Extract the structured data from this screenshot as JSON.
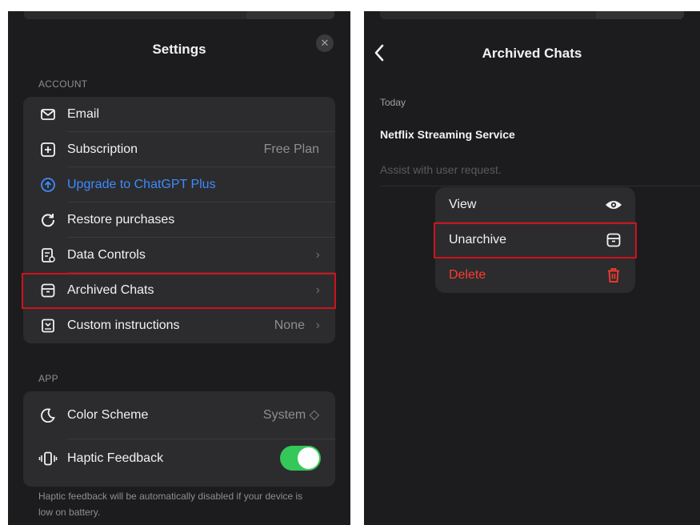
{
  "settings": {
    "title": "Settings",
    "close_glyph": "✕",
    "account_section": "ACCOUNT",
    "app_section": "APP",
    "account_rows": [
      {
        "label": "Email",
        "icon": "envelope-icon"
      },
      {
        "label": "Subscription",
        "value": "Free Plan",
        "icon": "plus-square-icon"
      },
      {
        "label": "Upgrade to ChatGPT Plus",
        "icon": "upgrade-arrow-icon"
      },
      {
        "label": "Restore purchases",
        "icon": "restore-icon"
      },
      {
        "label": "Data Controls",
        "chevron": "›",
        "icon": "data-controls-icon"
      },
      {
        "label": "Archived Chats",
        "chevron": "›",
        "icon": "archive-box-icon"
      },
      {
        "label": "Custom instructions",
        "value": "None",
        "chevron": "›",
        "icon": "instructions-icon"
      }
    ],
    "app_rows": [
      {
        "label": "Color Scheme",
        "value": "System ◇",
        "icon": "moon-icon"
      },
      {
        "label": "Haptic Feedback",
        "toggle": "on",
        "icon": "haptic-icon"
      }
    ],
    "footnote": "Haptic feedback will be automatically disabled if your device is low on battery."
  },
  "archived": {
    "title": "Archived Chats",
    "back_glyph": "‹",
    "group_label": "Today",
    "chat_title": "Netflix Streaming Service",
    "chat_subtitle": "Assist with user request.",
    "menu": [
      {
        "label": "View",
        "icon": "eye-icon"
      },
      {
        "label": "Unarchive",
        "icon": "unarchive-box-icon"
      },
      {
        "label": "Delete",
        "icon": "trash-icon"
      }
    ]
  },
  "colors": {
    "background": "#1c1c1e",
    "group": "#2c2c2e",
    "accent_blue": "#3d8bfd",
    "toggle_green": "#34c759",
    "destructive_red": "#ff3b30",
    "highlight_box": "#d0121b"
  }
}
